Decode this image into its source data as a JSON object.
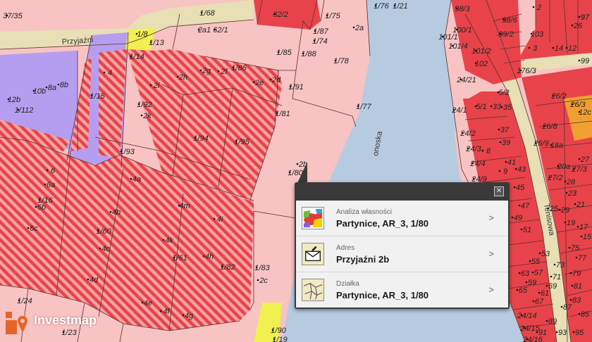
{
  "map": {
    "road_label": "Przyjaźni",
    "road_label_2": "Tenisowa",
    "road_label_3": "onoska",
    "parcels": [
      "37/35",
      "1/68",
      "62/2",
      "1/75",
      "1/76",
      "1/21",
      "98/3",
      "97",
      "98/6",
      "2",
      "62/1",
      "1/8",
      "1/87",
      "2a",
      "1/13",
      "1/74",
      "1/85",
      "1/88",
      "100/1",
      "99/2",
      "103",
      "1/14",
      "2g",
      "2f",
      "1/86",
      "1/78",
      "101/1",
      "101/2",
      "1/15",
      "4",
      "2h",
      "2i",
      "2e",
      "2d",
      "1/91",
      "101/4",
      "102",
      "3",
      "176/3",
      "1/112",
      "12b",
      "10b",
      "8a",
      "8b",
      "1/92",
      "2k",
      "1/77",
      "24/21",
      "5/2",
      "1/93",
      "1/94",
      "1/95",
      "1/81",
      "24/1",
      "5/1",
      "26/2",
      "26/3",
      "12c",
      "26/8",
      "24/2",
      "6",
      "18a",
      "26/9",
      "27",
      "1/16",
      "6a",
      "6b",
      "6c",
      "4a",
      "4b",
      "1/60",
      "4c",
      "4m",
      "4i",
      "4k",
      "4h",
      "1/61",
      "1/82",
      "1/83",
      "4d",
      "4e",
      "4f",
      "4g",
      "2c",
      "1/24",
      "1/23",
      "1/90",
      "1/19",
      "24/3",
      "24/4",
      "24/9",
      "8",
      "9",
      "37",
      "39",
      "33",
      "35",
      "41",
      "43",
      "45",
      "47",
      "49",
      "51",
      "53",
      "55",
      "57",
      "59",
      "61",
      "63",
      "65",
      "67",
      "69",
      "71",
      "73",
      "75",
      "77",
      "79",
      "81",
      "83",
      "85",
      "87",
      "89",
      "91",
      "93",
      "95",
      "97",
      "99",
      "1/80",
      "2b",
      "25",
      "29",
      "14",
      "12",
      "26",
      "24/15",
      "20a",
      "27/3",
      "28",
      "27/2",
      "23",
      "21",
      "19",
      "17",
      "15",
      "24/14",
      "24/16",
      "2a1"
    ]
  },
  "popup": {
    "close_label": "✕",
    "rows": [
      {
        "category": "Analiza własności",
        "value": "Partynice, AR_3, 1/80",
        "icon": "ownership-analysis-icon"
      },
      {
        "category": "Adres",
        "value": "Przyjaźni 2b",
        "icon": "address-envelope-icon"
      },
      {
        "category": "Działka",
        "value": "Partynice, AR_3, 1/80",
        "icon": "parcel-map-icon"
      }
    ],
    "arrow_label": ">"
  },
  "brand": {
    "name": "Investmap"
  }
}
